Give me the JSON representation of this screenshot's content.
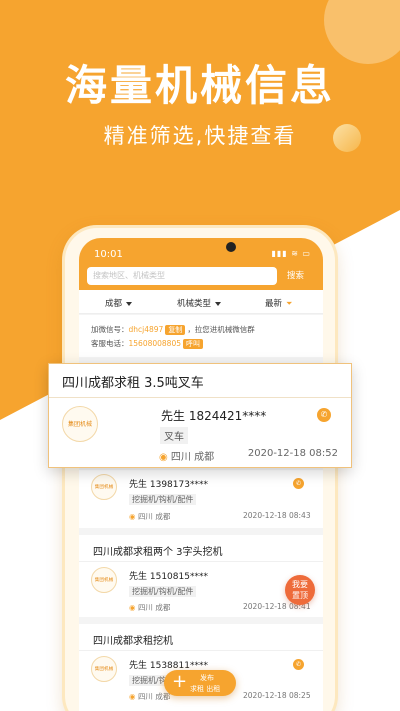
{
  "promo": {
    "headline": "海量机械信息",
    "subline": "精准筛选,快捷查看"
  },
  "status": {
    "time": "10:01",
    "icons": "▮▮▮ ≋ ▭"
  },
  "search": {
    "placeholder": "搜索地区、机械类型",
    "button": "搜索"
  },
  "filters": {
    "city": "成都",
    "type": "机械类型",
    "sort": "最新"
  },
  "notice": {
    "wechat_label": "加微信号：",
    "wechat_id": "dhcj4897",
    "copy_btn": "复制",
    "wechat_suffix": "，拉您进机械微信群",
    "phone_label": "客服电话：",
    "phone": "15608008805",
    "call_btn": "呼叫"
  },
  "logo_text": "集团机械",
  "listings": [
    {
      "title": "四川成都求租 3.5吨叉车",
      "contact": "先生  1824421****",
      "tags": [
        "叉车"
      ],
      "location": "四川 成都",
      "time": "2020-12-18 08:52"
    },
    {
      "title": "",
      "contact": "先生  1398173****",
      "tags": [
        "挖掘机/钩机/配件"
      ],
      "location": "四川 成都",
      "time": "2020-12-18 08:43"
    },
    {
      "title": "四川成都求租两个 3字头挖机",
      "contact": "先生  1510815****",
      "tags": [
        "挖掘机/钩机/配件"
      ],
      "location": "四川 成都",
      "time": "2020-12-18 08:41"
    },
    {
      "title": "四川成都求租挖机",
      "contact": "先生  1538811****",
      "tags": [
        "挖掘机/钩"
      ],
      "location": "四川 成都",
      "time": "2020-12-18 08:25"
    }
  ],
  "floating": {
    "top_badge_line1": "我要",
    "top_badge_line2": "置顶",
    "fab_plus": "+",
    "fab_line1": "发布",
    "fab_line2": "求租 出租"
  },
  "colors": {
    "accent": "#f6a42f",
    "badge": "#ee6b3a"
  },
  "icons": {
    "call": "phone-icon",
    "location": "location-pin-icon",
    "filter": "funnel-icon"
  }
}
